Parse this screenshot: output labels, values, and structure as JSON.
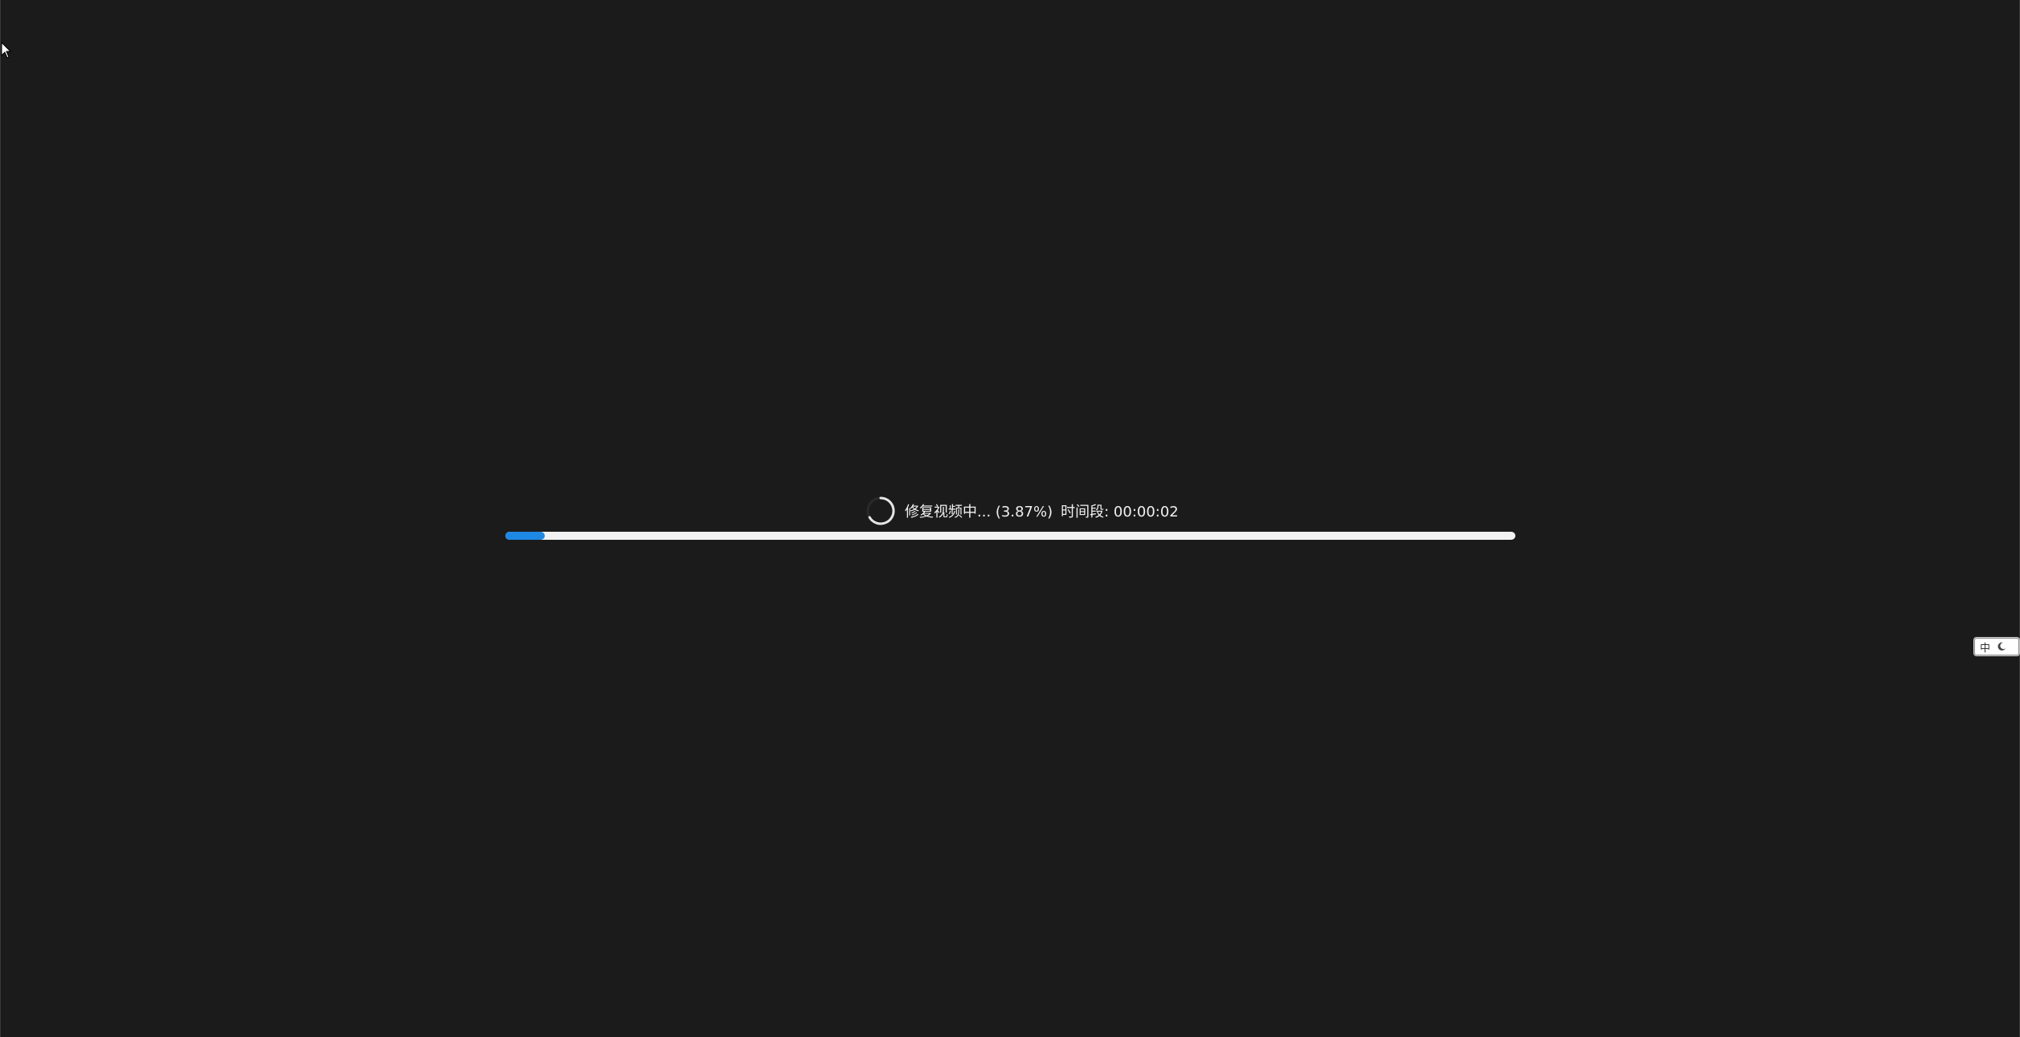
{
  "status": {
    "repair_label": "修复视频中... (3.87%)",
    "segment_label": "时间段: 00:00:02"
  },
  "progress": {
    "percent": 3.87,
    "track_color": "#f2f2f2",
    "fill_color": "#1e88e5"
  },
  "ime": {
    "mode": "中",
    "icon": "moon-icon"
  },
  "colors": {
    "background": "#1b1b1b",
    "text": "#f0f0f0"
  }
}
